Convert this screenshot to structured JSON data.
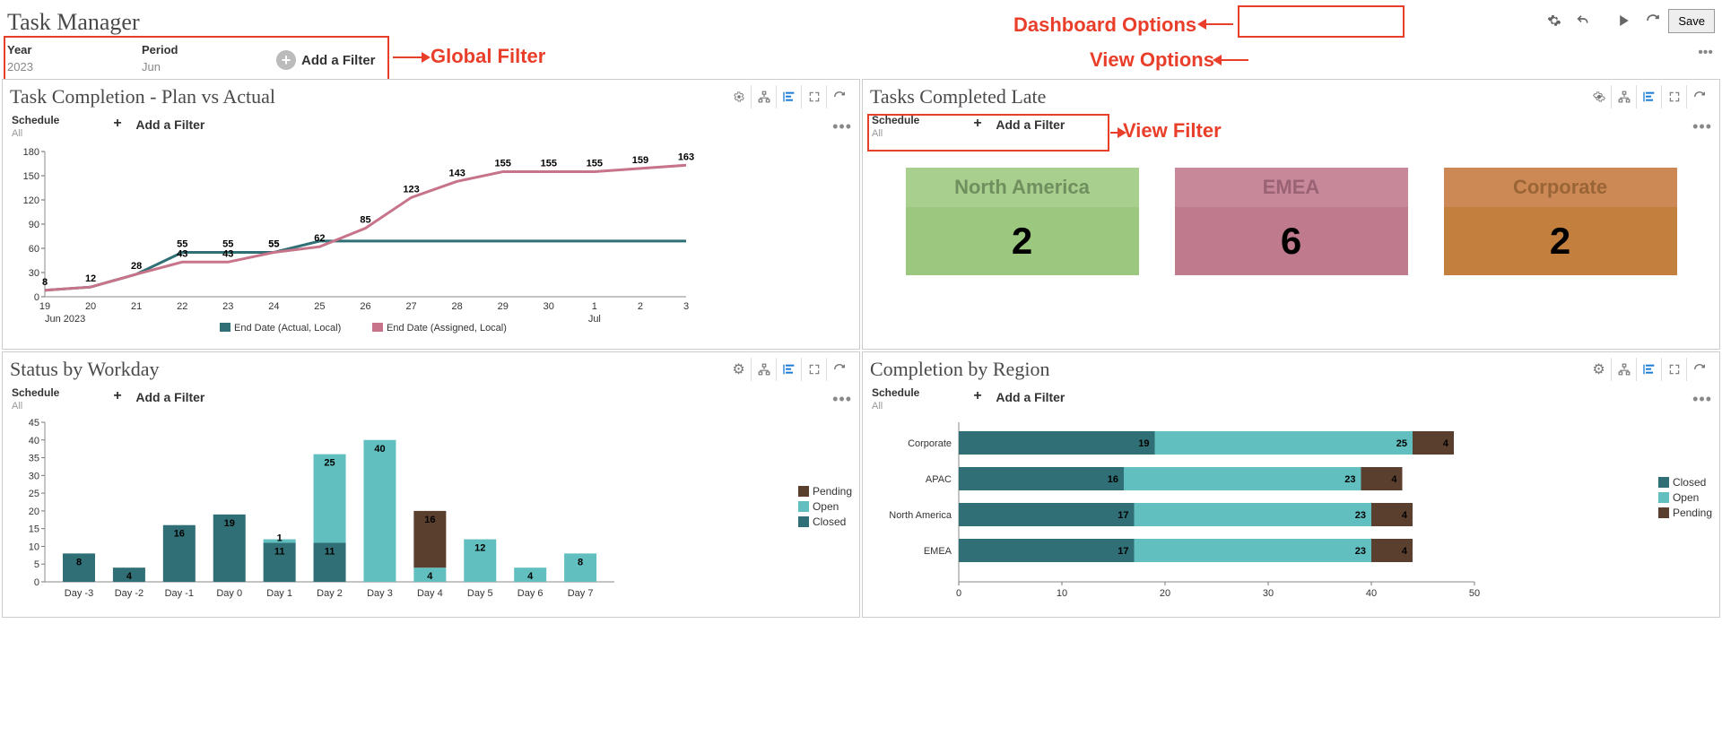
{
  "page_title": "Task Manager",
  "toolbar": {
    "save": "Save"
  },
  "annotations": {
    "dashboard_options": "Dashboard Options",
    "view_options": "View Options",
    "global_filter": "Global Filter",
    "view_filter": "View Filter"
  },
  "global_filter": {
    "items": [
      {
        "label": "Year",
        "value": "2023"
      },
      {
        "label": "Period",
        "value": "Jun"
      }
    ],
    "add": "Add a Filter"
  },
  "panels": {
    "plan_vs_actual": {
      "title": "Task Completion - Plan vs Actual",
      "filter_label": "Schedule",
      "filter_value": "All",
      "add_filter": "Add a Filter",
      "x_start": "Jun 2023",
      "x_mid": "Jul",
      "legend": [
        "End Date (Actual, Local)",
        "End Date (Assigned, Local)"
      ]
    },
    "late": {
      "title": "Tasks Completed Late",
      "filter_label": "Schedule",
      "filter_value": "All",
      "add_filter": "Add a Filter",
      "cards": [
        {
          "name": "North America",
          "value": "2"
        },
        {
          "name": "EMEA",
          "value": "6"
        },
        {
          "name": "Corporate",
          "value": "2"
        }
      ]
    },
    "status": {
      "title": "Status by Workday",
      "filter_label": "Schedule",
      "filter_value": "All",
      "add_filter": "Add a Filter",
      "legend": [
        "Pending",
        "Open",
        "Closed"
      ]
    },
    "region": {
      "title": "Completion by Region",
      "filter_label": "Schedule",
      "filter_value": "All",
      "add_filter": "Add a Filter",
      "legend": [
        "Closed",
        "Open",
        "Pending"
      ]
    }
  },
  "colors": {
    "teal": "#2f6f75",
    "cyan": "#62bfc0",
    "brown": "#5b3f2e",
    "pink": "#c7748a"
  },
  "chart_data": [
    {
      "id": "plan_vs_actual",
      "type": "line",
      "x": [
        "19",
        "20",
        "21",
        "22",
        "23",
        "24",
        "25",
        "26",
        "27",
        "28",
        "29",
        "30",
        "1",
        "2",
        "3"
      ],
      "series": [
        {
          "name": "End Date (Actual, Local)",
          "values": [
            8,
            12,
            28,
            55,
            55,
            55,
            69,
            69,
            69,
            69,
            69,
            69,
            69,
            69,
            69
          ]
        },
        {
          "name": "End Date (Assigned, Local)",
          "values": [
            8,
            12,
            28,
            43,
            43,
            55,
            62,
            85,
            123,
            143,
            155,
            155,
            155,
            159,
            163
          ]
        }
      ],
      "ylim": [
        0,
        180
      ],
      "yticks": [
        0,
        30,
        60,
        90,
        120,
        150,
        180
      ]
    },
    {
      "id": "tasks_late",
      "type": "table",
      "categories": [
        "North America",
        "EMEA",
        "Corporate"
      ],
      "values": [
        2,
        6,
        2
      ]
    },
    {
      "id": "status_by_workday",
      "type": "bar",
      "categories": [
        "Day -3",
        "Day -2",
        "Day -1",
        "Day 0",
        "Day 1",
        "Day 2",
        "Day 3",
        "Day 4",
        "Day 5",
        "Day 6",
        "Day 7"
      ],
      "series": [
        {
          "name": "Closed",
          "values": [
            8,
            4,
            16,
            19,
            11,
            11,
            0,
            0,
            0,
            0,
            0
          ]
        },
        {
          "name": "Open",
          "values": [
            0,
            0,
            0,
            0,
            1,
            25,
            40,
            4,
            12,
            4,
            8
          ]
        },
        {
          "name": "Pending",
          "values": [
            0,
            0,
            0,
            0,
            0,
            0,
            0,
            16,
            0,
            0,
            0
          ]
        }
      ],
      "ylim": [
        0,
        45
      ],
      "yticks": [
        0,
        5,
        10,
        15,
        20,
        25,
        30,
        35,
        40,
        45
      ]
    },
    {
      "id": "completion_by_region",
      "type": "bar",
      "orientation": "horizontal",
      "categories": [
        "Corporate",
        "APAC",
        "North America",
        "EMEA"
      ],
      "series": [
        {
          "name": "Closed",
          "values": [
            19,
            16,
            17,
            17
          ]
        },
        {
          "name": "Open",
          "values": [
            25,
            23,
            23,
            23
          ]
        },
        {
          "name": "Pending",
          "values": [
            4,
            4,
            4,
            4
          ]
        }
      ],
      "xlim": [
        0,
        50
      ],
      "xticks": [
        0,
        10,
        20,
        30,
        40,
        50
      ]
    }
  ]
}
